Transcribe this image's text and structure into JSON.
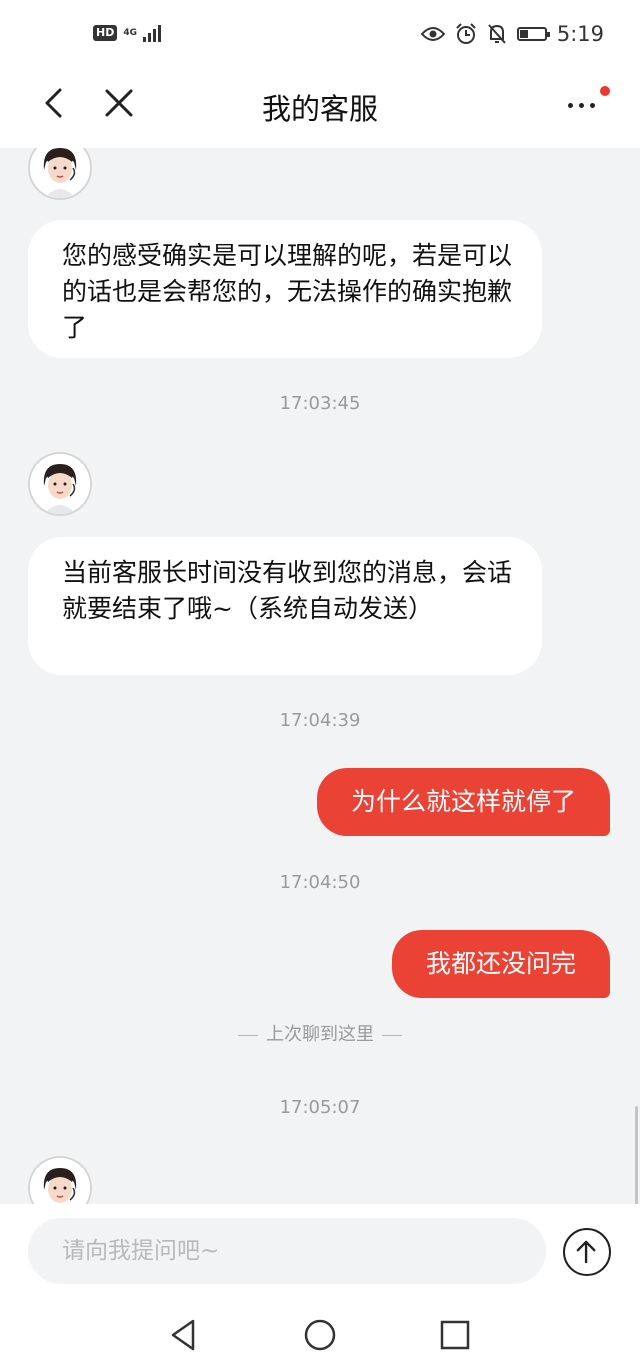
{
  "status_bar": {
    "hd_label": "HD",
    "network": "4G",
    "time": "5:19",
    "battery_level": 0.3
  },
  "header": {
    "title": "我的客服",
    "notification_dot_color": "#e8382f"
  },
  "messages": [
    {
      "role": "agent",
      "text": "您的感受确实是可以理解的呢，若是可以的话也是会帮您的，无法操作的确实抱歉了"
    },
    {
      "role": "timestamp",
      "text": "17:03:45"
    },
    {
      "role": "agent",
      "text": "当前客服长时间没有收到您的消息，会话就要结束了哦~（系统自动发送）"
    },
    {
      "role": "timestamp",
      "text": "17:04:39"
    },
    {
      "role": "user",
      "text": "为什么就这样就停了"
    },
    {
      "role": "timestamp",
      "text": "17:04:50"
    },
    {
      "role": "user",
      "text": "我都还没问完"
    },
    {
      "role": "divider",
      "text": "上次聊到这里"
    },
    {
      "role": "timestamp",
      "text": "17:05:07"
    }
  ],
  "input": {
    "placeholder": "请向我提问吧~"
  },
  "colors": {
    "accent": "#ea4336",
    "background": "#f2f3f5",
    "bubble_in": "#ffffff"
  },
  "icons": [
    "back-icon",
    "close-icon",
    "more-icon",
    "send-icon",
    "nav-back-icon",
    "nav-home-icon",
    "nav-recents-icon"
  ]
}
